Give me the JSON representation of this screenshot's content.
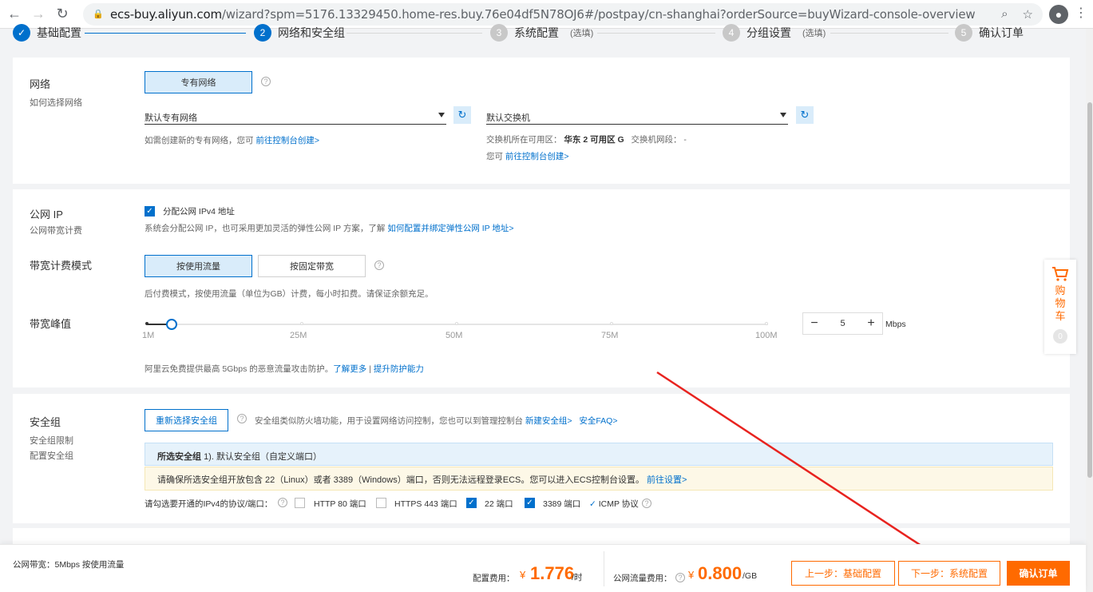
{
  "browser": {
    "url_host": "ecs-buy.aliyun.com",
    "url_path": "/wizard?spm=5176.13329450.home-res.buy.76e04df5N78OJ6#/postpay/cn-shanghai?orderSource=buyWizard-console-overview"
  },
  "steps": [
    {
      "num": "✓",
      "label": "基础配置",
      "optional": ""
    },
    {
      "num": "2",
      "label": "网络和安全组",
      "optional": ""
    },
    {
      "num": "3",
      "label": "系统配置",
      "optional": "(选填)"
    },
    {
      "num": "4",
      "label": "分组设置",
      "optional": "(选填)"
    },
    {
      "num": "5",
      "label": "确认订单",
      "optional": ""
    }
  ],
  "network": {
    "title": "网络",
    "subtitle": "如何选择网络",
    "type_button": "专有网络",
    "vpc_select": "默认专有网络",
    "vswitch_select": "默认交换机",
    "vpc_note_prefix": "如需创建新的专有网络，您可",
    "vpc_note_link": "前往控制台创建>",
    "zone_label": "交换机所在可用区：",
    "zone_value": "华东 2 可用区 G",
    "cidr_label": "交换机网段：",
    "cidr_value": "-",
    "vswitch_note_prefix": "您可",
    "vswitch_note_link": "前往控制台创建>"
  },
  "public_ip": {
    "title": "公网 IP",
    "subtitle": "公网带宽计费",
    "checkbox_label": "分配公网 IPv4 地址",
    "note_prefix": "系统会分配公网 IP，也可采用更加灵活的弹性公网 IP 方案，了解",
    "note_link": "如何配置并绑定弹性公网 IP 地址>",
    "billing_title": "带宽计费模式",
    "billing_by_traffic": "按使用流量",
    "billing_fixed": "按固定带宽",
    "billing_note": "后付费模式，按使用流量（单位为GB）计费，每小时扣费。请保证余额充足。",
    "peak_title": "带宽峰值",
    "ticks": [
      "1M",
      "25M",
      "50M",
      "75M",
      "100M"
    ],
    "bandwidth_value": "5",
    "bandwidth_unit": "Mbps",
    "bandwidth_fraction": 0.04,
    "ddos_note": "阿里云免费提供最高 5Gbps 的恶意流量攻击防护。",
    "ddos_link1": "了解更多",
    "ddos_sep": "|",
    "ddos_link2": "提升防护能力"
  },
  "security_group": {
    "title": "安全组",
    "subtitle1": "安全组限制",
    "subtitle2": "配置安全组",
    "reselect_button": "重新选择安全组",
    "note": "安全组类似防火墙功能，用于设置网络访问控制，您也可以到管理控制台",
    "new_link": "新建安全组>",
    "faq_link": "安全FAQ>",
    "selected_label": "所选安全组",
    "selected_value": "1). 默认安全组（自定义端口）",
    "warning": "请确保所选安全组开放包含 22（Linux）或者 3389（Windows）端口，否则无法远程登录ECS。您可以进入ECS控制台设置。",
    "warning_link": "前往设置>",
    "ports_label": "请勾选要开通的IPv4的协议/端口：",
    "ports": [
      {
        "label": "HTTP 80 端口",
        "checked": false
      },
      {
        "label": "HTTPS 443 端口",
        "checked": false
      },
      {
        "label": "22 端口",
        "checked": true
      },
      {
        "label": "3389 端口",
        "checked": true
      }
    ],
    "icmp_label": "ICMP 协议"
  },
  "cart": {
    "label": "购物车",
    "count": "0"
  },
  "footer": {
    "bandwidth_summary": "公网带宽：5Mbps 按使用流量",
    "config_fee_label": "配置费用：",
    "currency": "¥",
    "config_fee": "1.776",
    "config_fee_unit": "/时",
    "traffic_fee_label": "公网流量费用：",
    "traffic_fee": "0.800",
    "traffic_fee_unit": "/GB",
    "prev_button": "上一步：基础配置",
    "next_button": "下一步：系统配置",
    "confirm_button": "确认订单"
  },
  "colors": {
    "brand": "#0070cc",
    "accent": "#ff6a00",
    "annotation_arrow": "#e8231f"
  }
}
